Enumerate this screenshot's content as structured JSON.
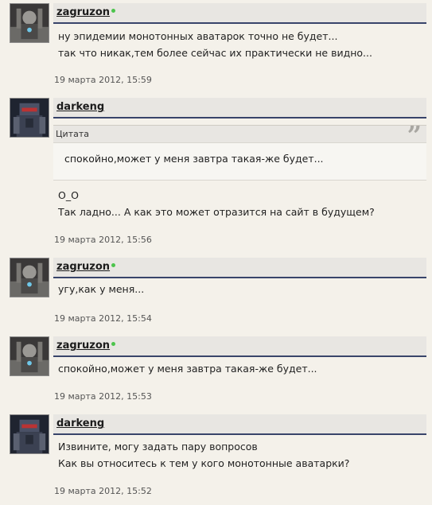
{
  "quote_label": "Цитата",
  "posts": [
    {
      "user": "zagruzon",
      "online": true,
      "lines": [
        "ну эпидемии монотонных аватарок точно не будет...",
        "так что никак,тем более сейчас их практически не видно..."
      ],
      "date": "19 марта 2012, 15:59"
    },
    {
      "user": "darkeng",
      "online": false,
      "quote": "спокойно,может у меня завтра такая-же будет...",
      "lines": [
        "O_O",
        "Так ладно... А как это может отразится на сайт в будущем?"
      ],
      "date": "19 марта 2012, 15:56"
    },
    {
      "user": "zagruzon",
      "online": true,
      "lines": [
        "угу,как у меня..."
      ],
      "date": "19 марта 2012, 15:54"
    },
    {
      "user": "zagruzon",
      "online": true,
      "lines": [
        "спокойно,может у меня завтра такая-же будет..."
      ],
      "date": "19 марта 2012, 15:53"
    },
    {
      "user": "darkeng",
      "online": false,
      "lines": [
        "Извините, могу задать пару вопросов",
        "Как вы относитесь к тем у кого монотонные аватарки?"
      ],
      "date": "19 марта 2012, 15:52"
    }
  ]
}
